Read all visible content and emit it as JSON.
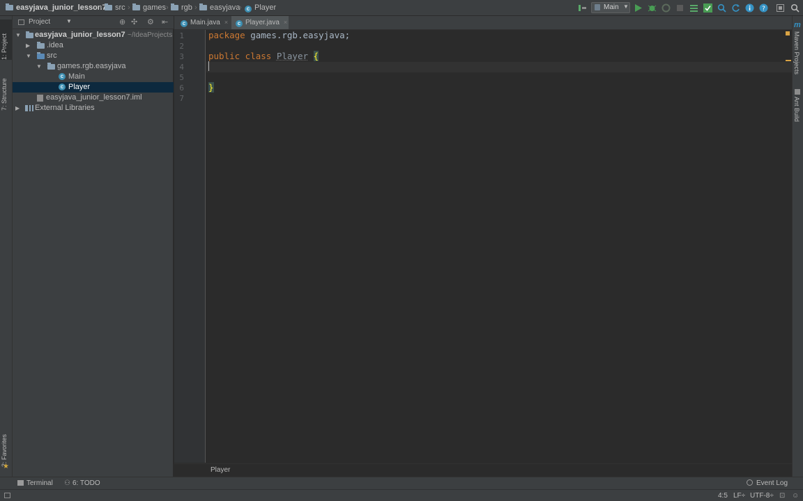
{
  "navbar": {
    "project": "easyjava_junior_lesson7",
    "crumbs": [
      "src",
      "games",
      "rgb",
      "easyjava"
    ],
    "file": "Player",
    "run_config": "Main"
  },
  "left_strip": {
    "project_tab": "1: Project",
    "structure_tab": "7: Structure",
    "favorites_tab": "2: Favorites"
  },
  "right_strip": {
    "maven_tab": "Maven Projects",
    "ant_tab": "Ant Build"
  },
  "project_panel": {
    "header": "Project",
    "tree": {
      "root": "easyjava_junior_lesson7",
      "root_path": "~/IdeaProjects",
      "idea": ".idea",
      "src": "src",
      "package": "games.rgb.easyjava",
      "main": "Main",
      "player": "Player",
      "iml": "easyjava_junior_lesson7.iml",
      "libs": "External Libraries"
    }
  },
  "editor": {
    "tabs": [
      {
        "label": "Main.java",
        "close": "×"
      },
      {
        "label": "Player.java",
        "close": "×"
      }
    ],
    "line_numbers": [
      "1",
      "2",
      "3",
      "4",
      "5",
      "6",
      "7"
    ],
    "code": {
      "kw_package": "package",
      "pkg_name": " games.rgb.easyjava;",
      "kw_public": "public",
      "kw_class": " class ",
      "class_name": "Player",
      "open_brace": "{",
      "close_brace": "}"
    },
    "breadcrumb": "Player"
  },
  "bottom_tools": {
    "terminal": "Terminal",
    "todo": "6: TODO",
    "event_log": "Event Log"
  },
  "status": {
    "position": "4:5",
    "line_sep": "LF÷",
    "encoding": "UTF-8÷"
  },
  "colors": {
    "accent_run": "#499c54",
    "selection": "#0d293e",
    "keyword": "#cc7832"
  }
}
